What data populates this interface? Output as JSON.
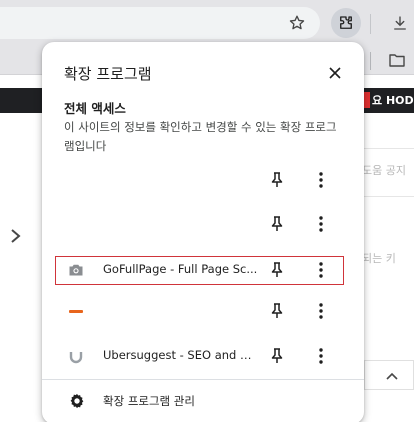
{
  "browser": {
    "bookmarks_bar_partial": "요 HOD"
  },
  "popup": {
    "title": "확장 프로그램",
    "section_title": "전체 액세스",
    "section_description": "이 사이트의 정보를 확인하고 변경할 수 있는 확장 프로그램입니다",
    "extensions": [
      {
        "name": "",
        "icon": "blank"
      },
      {
        "name": "",
        "icon": "blank"
      },
      {
        "name": "GoFullPage - Full Page Sc...",
        "icon": "camera-icon",
        "highlighted": true
      },
      {
        "name": "",
        "icon": "orange-extension-icon"
      },
      {
        "name": "Ubersuggest - SEO and K...",
        "icon": "ubersuggest-icon"
      }
    ],
    "manage_label": "확장 프로그램 관리"
  },
  "background_page": {
    "fragments": [
      "도움 공지",
      "되는 키"
    ]
  },
  "colors": {
    "highlight_border": "#d0343a",
    "toolbar_bg": "#e4e4e7",
    "dark_bar_bg": "#1f2023"
  }
}
